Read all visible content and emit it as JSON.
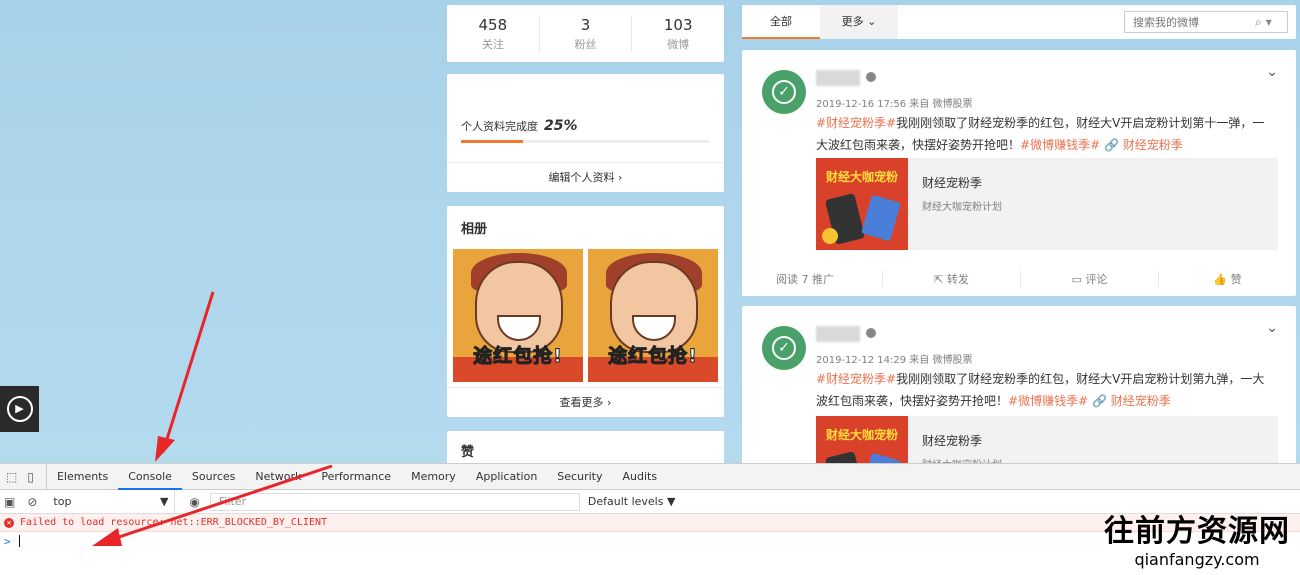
{
  "stats": [
    {
      "num": "458",
      "label": "关注"
    },
    {
      "num": "3",
      "label": "粉丝"
    },
    {
      "num": "103",
      "label": "微博"
    }
  ],
  "profile": {
    "label": "个人资料完成度",
    "percent": "25%",
    "progress": 0.25,
    "edit": "编辑个人资料 ›"
  },
  "album": {
    "title": "相册",
    "caption_a": "途",
    "caption_b": "红包",
    "caption_c": "抢!",
    "more": "查看更多 ›"
  },
  "likes": {
    "title": "赞"
  },
  "feed": {
    "tab_all": "全部",
    "tab_more": "更多 ⌄",
    "search_placeholder": "搜索我的微博"
  },
  "posts": [
    {
      "meta": "2019-12-16 17:56 来自 微博股票",
      "text_a": "#财经宠粉季#",
      "text_b": "我刚刚领取了财经宠粉季的红包，财经大V开启宠粉计划第十一弹，一大波红包雨来袭，快摆好姿势开抢吧！",
      "text_c": "#微博赚钱季#",
      "text_d": "🔗 财经宠粉季",
      "share_title": "财经宠粉季",
      "share_sub": "财经大咖宠粉计划",
      "thumb_text": "财经大咖宠粉",
      "actions": [
        "阅读 7    推广",
        "转发",
        "评论",
        "赞"
      ]
    },
    {
      "meta": "2019-12-12 14:29 来自 微博股票",
      "text_a": "#财经宠粉季#",
      "text_b": "我刚刚领取了财经宠粉季的红包，财经大V开启宠粉计划第九弹，一大波红包雨来袭，快摆好姿势开抢吧！",
      "text_c": "#微博赚钱季#",
      "text_d": "🔗 财经宠粉季",
      "share_title": "财经宠粉季",
      "share_sub": "财经大咖宠粉计划",
      "thumb_text": "财经大咖宠粉"
    }
  ],
  "devtools": {
    "tabs": [
      "Elements",
      "Console",
      "Sources",
      "Network",
      "Performance",
      "Memory",
      "Application",
      "Security",
      "Audits"
    ],
    "active_tab": "Console",
    "context": "top",
    "context_arrow": "▼",
    "filter_placeholder": "Filter",
    "levels": "Default levels ▼",
    "error": "Failed to load resource: net::ERR_BLOCKED_BY_CLIENT",
    "prompt": ">"
  },
  "watermark": {
    "cn": "往前方资源网",
    "en": "qianfangzy.com"
  },
  "colors": {
    "accent": "#f07a2e",
    "tag": "#eb7350",
    "error": "#e0302a",
    "devtools_active": "#1a73e8",
    "arrow": "#e8262a"
  }
}
